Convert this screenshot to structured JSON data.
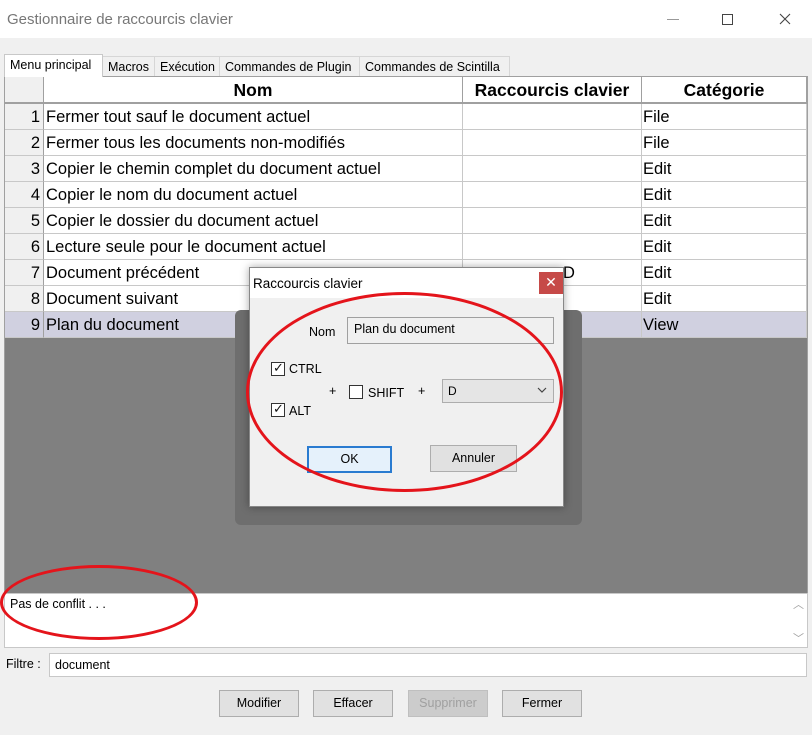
{
  "window": {
    "title": "Gestionnaire de raccourcis clavier"
  },
  "tabs": [
    {
      "label": "Menu principal",
      "active": true
    },
    {
      "label": "Macros",
      "active": false
    },
    {
      "label": "Exécution",
      "active": false
    },
    {
      "label": "Commandes de Plugin",
      "active": false
    },
    {
      "label": "Commandes de Scintilla",
      "active": false
    }
  ],
  "table": {
    "columns": [
      "Nom",
      "Raccourcis clavier",
      "Catégorie"
    ],
    "rows": [
      {
        "num": "1",
        "nom": "Fermer tout sauf le document actuel",
        "raccourci": "",
        "categorie": "File"
      },
      {
        "num": "2",
        "nom": "Fermer tous les documents non-modifiés",
        "raccourci": "",
        "categorie": "File"
      },
      {
        "num": "3",
        "nom": "Copier le chemin complet du document actuel",
        "raccourci": "",
        "categorie": "Edit"
      },
      {
        "num": "4",
        "nom": "Copier le nom du document actuel",
        "raccourci": "",
        "categorie": "Edit"
      },
      {
        "num": "5",
        "nom": "Copier le dossier du document actuel",
        "raccourci": "",
        "categorie": "Edit"
      },
      {
        "num": "6",
        "nom": "Lecture seule pour le document actuel",
        "raccourci": "",
        "categorie": "Edit"
      },
      {
        "num": "7",
        "nom": "Document précédent",
        "raccourci": "D",
        "categorie": "Edit"
      },
      {
        "num": "8",
        "nom": "Document suivant",
        "raccourci": "",
        "categorie": "Edit"
      },
      {
        "num": "9",
        "nom": "Plan du document",
        "raccourci": "",
        "categorie": "View",
        "selected": true
      }
    ]
  },
  "status": {
    "text": "Pas de conflit . . ."
  },
  "filter": {
    "label": "Filtre :",
    "value": "document"
  },
  "buttons": {
    "modifier": "Modifier",
    "effacer": "Effacer",
    "supprimer": "Supprimer",
    "fermer": "Fermer"
  },
  "dialog": {
    "title": "Raccourcis clavier",
    "close_glyph": "✕",
    "nom_label": "Nom",
    "nom_value": "Plan du document",
    "ctrl_label": "CTRL",
    "ctrl_checked": true,
    "alt_label": "ALT",
    "alt_checked": true,
    "shift_label": "SHIFT",
    "shift_checked": false,
    "plus": "+",
    "key_value": "D",
    "ok_label": "OK",
    "cancel_label": "Annuler"
  },
  "colors": {
    "annotation": "#e4141b",
    "selection": "#d0d0e0",
    "dialog_close": "#c64a48"
  }
}
